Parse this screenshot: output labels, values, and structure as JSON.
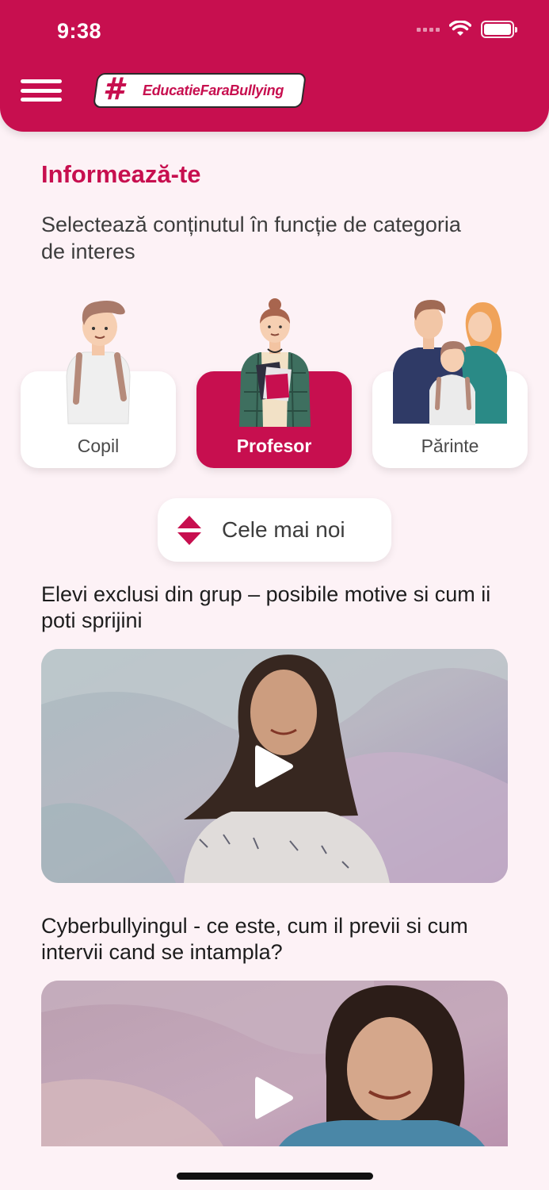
{
  "status_bar": {
    "time": "9:38"
  },
  "header": {
    "logo_text": "EducatieFaraBullying",
    "logo_hash": "#"
  },
  "page": {
    "title": "Informează-te",
    "subtitle": "Selectează conținutul în funcție de categoria de interes"
  },
  "categories": [
    {
      "label": "Copil",
      "selected": false,
      "icon": "child-illustration"
    },
    {
      "label": "Profesor",
      "selected": true,
      "icon": "teacher-illustration"
    },
    {
      "label": "Părinte",
      "selected": false,
      "icon": "parents-illustration"
    }
  ],
  "sort": {
    "label": "Cele mai noi",
    "icon": "sort-updown-icon"
  },
  "articles": [
    {
      "title": "Elevi exclusi din grup – posibile motive si cum ii poti sprijini",
      "media": "video"
    },
    {
      "title": "Cyberbullyingul - ce este, cum il previi si cum intervii cand se intampla?",
      "media": "video"
    }
  ],
  "colors": {
    "brand": "#c70f4f",
    "background": "#fdf2f6",
    "card": "#ffffff"
  }
}
